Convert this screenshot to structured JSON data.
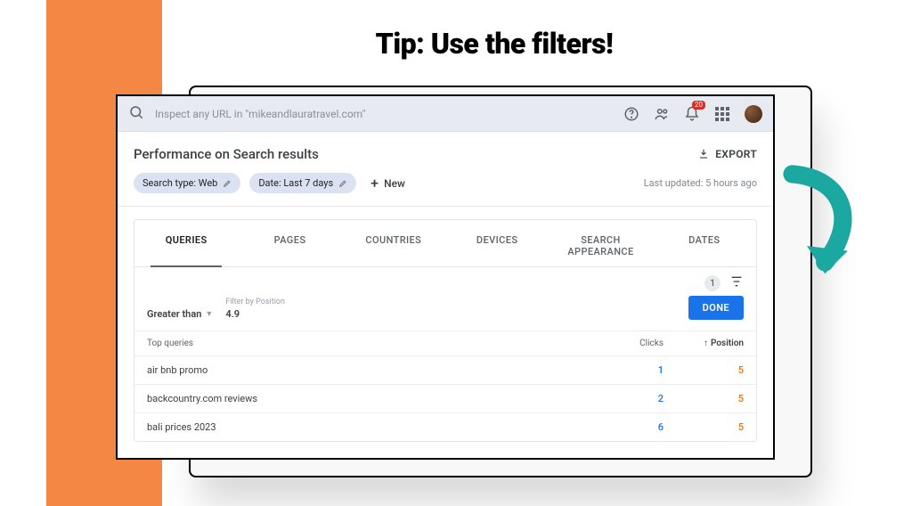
{
  "tip": "Tip: Use the filters!",
  "search": {
    "placeholder": "Inspect any URL in \"mikeandlauratravel.com\""
  },
  "topbar": {
    "notification_badge": "20"
  },
  "heading": "Performance on Search results",
  "export_label": "EXPORT",
  "chips": {
    "search_type": "Search type: Web",
    "date": "Date: Last 7 days",
    "new": "New"
  },
  "last_updated": "Last updated: 5 hours ago",
  "tabs": {
    "queries": "QUERIES",
    "pages": "PAGES",
    "countries": "COUNTRIES",
    "devices": "DEVICES",
    "appearance": "SEARCH APPEARANCE",
    "dates": "DATES"
  },
  "filter_count": "1",
  "filter": {
    "label": "Filter by Position",
    "operator": "Greater than",
    "value": "4.9",
    "done": "DONE"
  },
  "table": {
    "header_query": "Top queries",
    "header_clicks": "Clicks",
    "header_position": "Position",
    "rows": [
      {
        "q": "air bnb promo",
        "clicks": "1",
        "pos": "5"
      },
      {
        "q": "backcountry.com reviews",
        "clicks": "2",
        "pos": "5"
      },
      {
        "q": "bali prices 2023",
        "clicks": "6",
        "pos": "5"
      }
    ]
  }
}
